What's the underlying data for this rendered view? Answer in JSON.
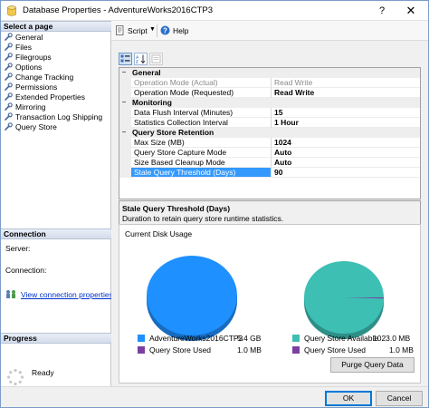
{
  "window": {
    "title": "Database Properties - AdventureWorks2016CTP3",
    "help_glyph": "?",
    "close_glyph": "✕"
  },
  "sidebar": {
    "select_page_label": "Select a page",
    "items": [
      {
        "label": "General"
      },
      {
        "label": "Files"
      },
      {
        "label": "Filegroups"
      },
      {
        "label": "Options"
      },
      {
        "label": "Change Tracking"
      },
      {
        "label": "Permissions"
      },
      {
        "label": "Extended Properties"
      },
      {
        "label": "Mirroring"
      },
      {
        "label": "Transaction Log Shipping"
      },
      {
        "label": "Query Store"
      }
    ],
    "connection_label": "Connection",
    "server_label": "Server:",
    "connection_field_label": "Connection:",
    "view_connection_link": "View connection properties",
    "progress_label": "Progress",
    "progress_status": "Ready"
  },
  "toolbar": {
    "script_label": "Script",
    "dropdown_glyph": "▼",
    "help_label": "Help"
  },
  "property_grid": {
    "categories": [
      {
        "label": "General",
        "rows": [
          {
            "name": "Operation Mode (Actual)",
            "value": "Read Write"
          },
          {
            "name": "Operation Mode (Requested)",
            "value": "Read Write"
          }
        ]
      },
      {
        "label": "Monitoring",
        "rows": [
          {
            "name": "Data Flush Interval (Minutes)",
            "value": "15"
          },
          {
            "name": "Statistics Collection Interval",
            "value": "1 Hour"
          }
        ]
      },
      {
        "label": "Query Store Retention",
        "rows": [
          {
            "name": "Max Size (MB)",
            "value": "1024"
          },
          {
            "name": "Query Store Capture Mode",
            "value": "Auto"
          },
          {
            "name": "Size Based Cleanup Mode",
            "value": "Auto"
          },
          {
            "name": "Stale Query Threshold (Days)",
            "value": "90"
          }
        ]
      }
    ],
    "collapse_glyph": "−"
  },
  "description": {
    "title": "Stale Query Threshold (Days)",
    "body": "Duration to retain query store runtime statistics."
  },
  "disk_usage": {
    "title": "Current Disk Usage",
    "colors": {
      "database": "#1e90ff",
      "query_store_used": "#7b3fa0",
      "query_store_available": "#3dbfb4"
    },
    "database_chart": {
      "legend": [
        {
          "label": "AdventureWorks2016CTP3",
          "value": "5.4 GB"
        },
        {
          "label": "Query Store Used",
          "value": "1.0 MB"
        }
      ]
    },
    "query_store_chart": {
      "legend": [
        {
          "label": "Query Store Available",
          "value": "1023.0 MB"
        },
        {
          "label": "Query Store Used",
          "value": "1.0 MB"
        }
      ]
    },
    "purge_button": "Purge Query Data"
  },
  "buttons": {
    "ok": "OK",
    "cancel": "Cancel"
  }
}
